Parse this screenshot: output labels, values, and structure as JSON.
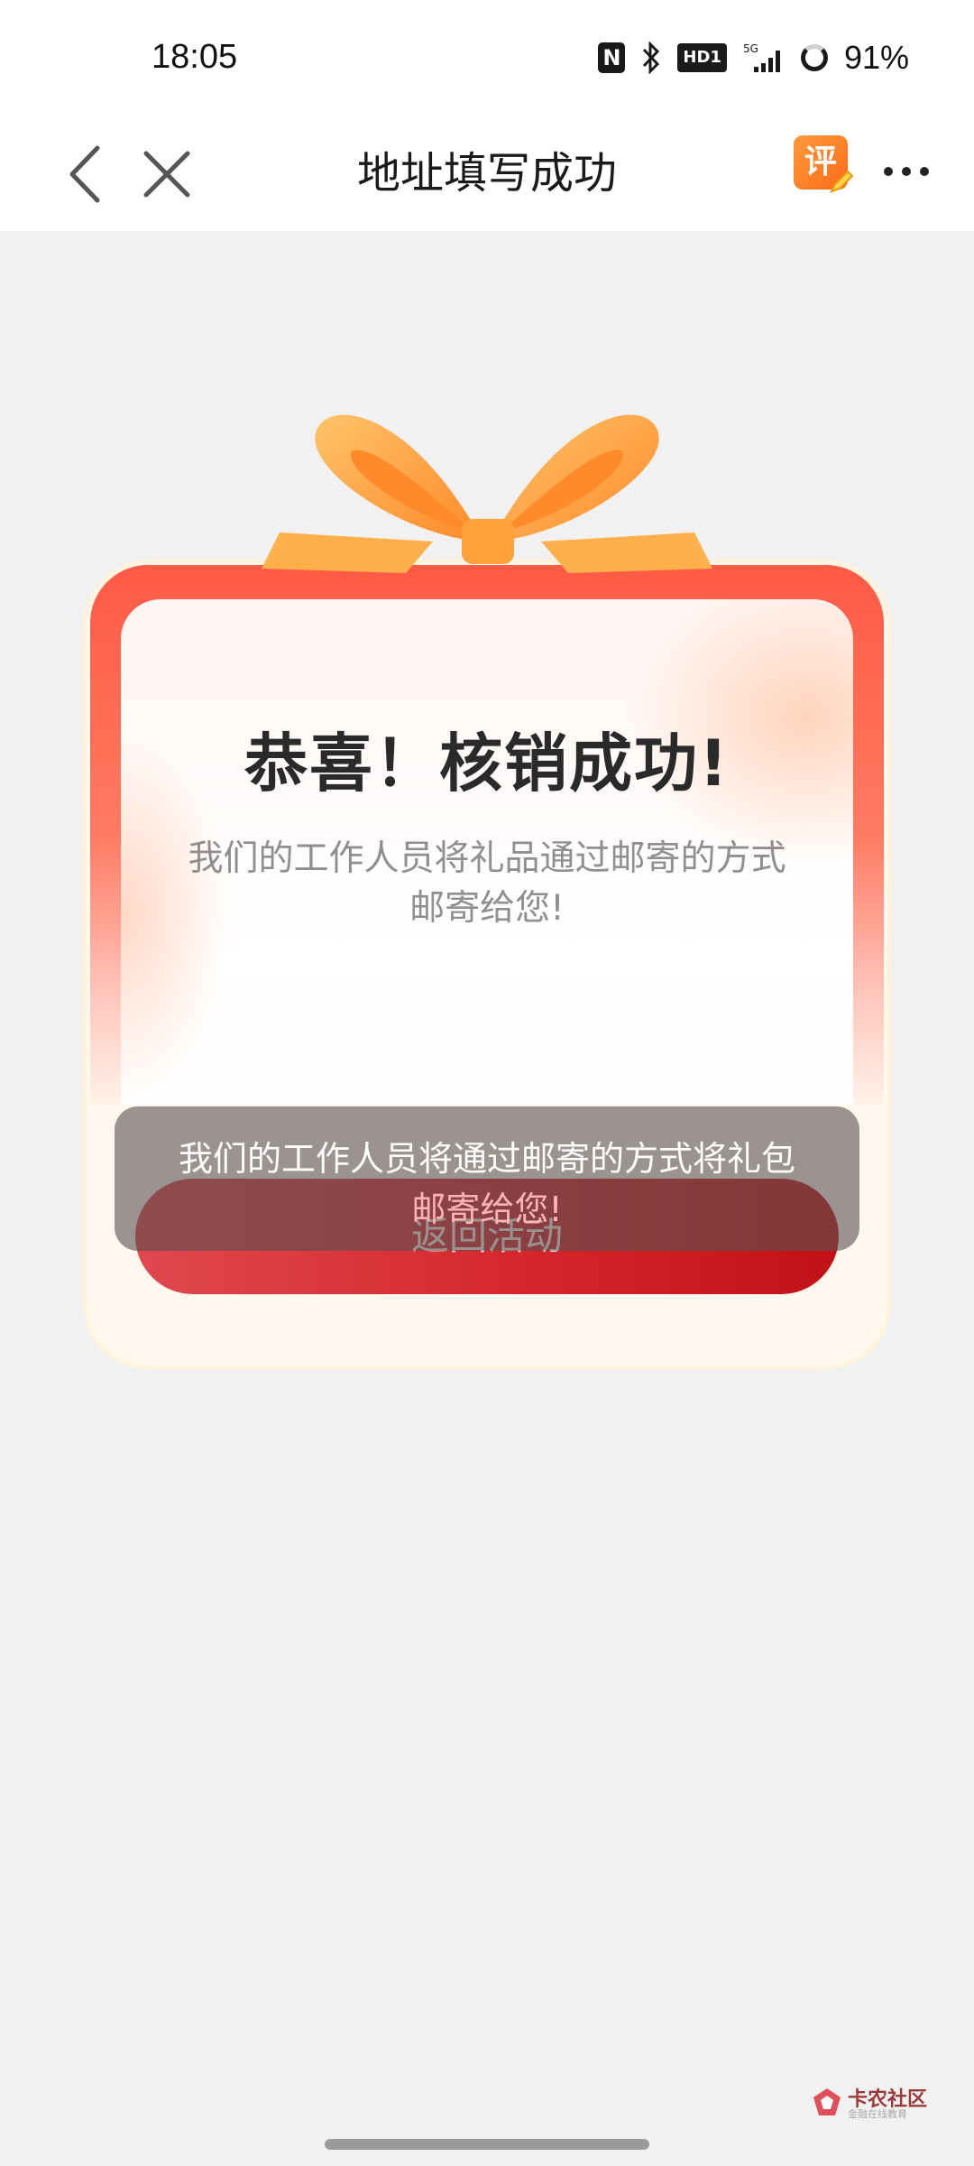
{
  "status_bar": {
    "time": "18:05",
    "network": "5G",
    "hd_label": "HD1",
    "battery": "91%"
  },
  "nav": {
    "title": "地址填写成功",
    "review_icon_glyph": "评"
  },
  "card": {
    "title": "恭喜！核销成功!",
    "description_line1": "我们的工作人员将礼品通过邮寄的方式",
    "description_line2": "邮寄给您!",
    "return_button": "返回活动"
  },
  "toast": {
    "line1": "我们的工作人员将通过邮寄的方式将礼包",
    "line2": "邮寄给您!"
  },
  "watermark": {
    "title": "卡农社区",
    "subtitle": "金融在线教育"
  },
  "colors": {
    "accent_red": "#e0484f",
    "ribbon_orange": "#ffa24a",
    "page_bg": "#f1f1f1"
  }
}
